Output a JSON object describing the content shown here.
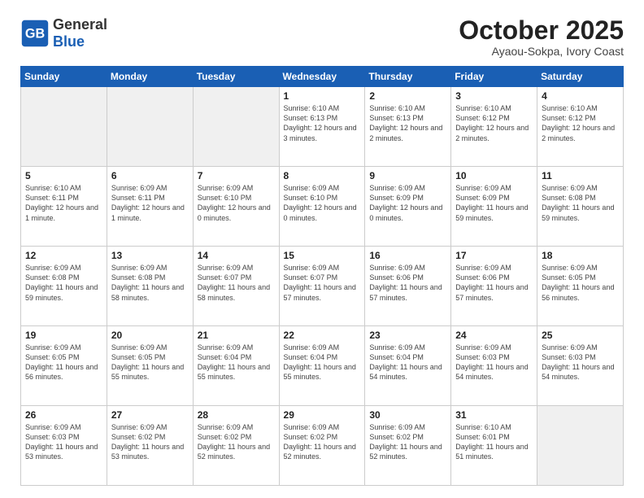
{
  "header": {
    "logo_general": "General",
    "logo_blue": "Blue",
    "month_title": "October 2025",
    "subtitle": "Ayaou-Sokpa, Ivory Coast"
  },
  "weekdays": [
    "Sunday",
    "Monday",
    "Tuesday",
    "Wednesday",
    "Thursday",
    "Friday",
    "Saturday"
  ],
  "weeks": [
    [
      {
        "day": "",
        "info": ""
      },
      {
        "day": "",
        "info": ""
      },
      {
        "day": "",
        "info": ""
      },
      {
        "day": "1",
        "info": "Sunrise: 6:10 AM\nSunset: 6:13 PM\nDaylight: 12 hours\nand 3 minutes."
      },
      {
        "day": "2",
        "info": "Sunrise: 6:10 AM\nSunset: 6:13 PM\nDaylight: 12 hours\nand 2 minutes."
      },
      {
        "day": "3",
        "info": "Sunrise: 6:10 AM\nSunset: 6:12 PM\nDaylight: 12 hours\nand 2 minutes."
      },
      {
        "day": "4",
        "info": "Sunrise: 6:10 AM\nSunset: 6:12 PM\nDaylight: 12 hours\nand 2 minutes."
      }
    ],
    [
      {
        "day": "5",
        "info": "Sunrise: 6:10 AM\nSunset: 6:11 PM\nDaylight: 12 hours\nand 1 minute."
      },
      {
        "day": "6",
        "info": "Sunrise: 6:09 AM\nSunset: 6:11 PM\nDaylight: 12 hours\nand 1 minute."
      },
      {
        "day": "7",
        "info": "Sunrise: 6:09 AM\nSunset: 6:10 PM\nDaylight: 12 hours\nand 0 minutes."
      },
      {
        "day": "8",
        "info": "Sunrise: 6:09 AM\nSunset: 6:10 PM\nDaylight: 12 hours\nand 0 minutes."
      },
      {
        "day": "9",
        "info": "Sunrise: 6:09 AM\nSunset: 6:09 PM\nDaylight: 12 hours\nand 0 minutes."
      },
      {
        "day": "10",
        "info": "Sunrise: 6:09 AM\nSunset: 6:09 PM\nDaylight: 11 hours\nand 59 minutes."
      },
      {
        "day": "11",
        "info": "Sunrise: 6:09 AM\nSunset: 6:08 PM\nDaylight: 11 hours\nand 59 minutes."
      }
    ],
    [
      {
        "day": "12",
        "info": "Sunrise: 6:09 AM\nSunset: 6:08 PM\nDaylight: 11 hours\nand 59 minutes."
      },
      {
        "day": "13",
        "info": "Sunrise: 6:09 AM\nSunset: 6:08 PM\nDaylight: 11 hours\nand 58 minutes."
      },
      {
        "day": "14",
        "info": "Sunrise: 6:09 AM\nSunset: 6:07 PM\nDaylight: 11 hours\nand 58 minutes."
      },
      {
        "day": "15",
        "info": "Sunrise: 6:09 AM\nSunset: 6:07 PM\nDaylight: 11 hours\nand 57 minutes."
      },
      {
        "day": "16",
        "info": "Sunrise: 6:09 AM\nSunset: 6:06 PM\nDaylight: 11 hours\nand 57 minutes."
      },
      {
        "day": "17",
        "info": "Sunrise: 6:09 AM\nSunset: 6:06 PM\nDaylight: 11 hours\nand 57 minutes."
      },
      {
        "day": "18",
        "info": "Sunrise: 6:09 AM\nSunset: 6:05 PM\nDaylight: 11 hours\nand 56 minutes."
      }
    ],
    [
      {
        "day": "19",
        "info": "Sunrise: 6:09 AM\nSunset: 6:05 PM\nDaylight: 11 hours\nand 56 minutes."
      },
      {
        "day": "20",
        "info": "Sunrise: 6:09 AM\nSunset: 6:05 PM\nDaylight: 11 hours\nand 55 minutes."
      },
      {
        "day": "21",
        "info": "Sunrise: 6:09 AM\nSunset: 6:04 PM\nDaylight: 11 hours\nand 55 minutes."
      },
      {
        "day": "22",
        "info": "Sunrise: 6:09 AM\nSunset: 6:04 PM\nDaylight: 11 hours\nand 55 minutes."
      },
      {
        "day": "23",
        "info": "Sunrise: 6:09 AM\nSunset: 6:04 PM\nDaylight: 11 hours\nand 54 minutes."
      },
      {
        "day": "24",
        "info": "Sunrise: 6:09 AM\nSunset: 6:03 PM\nDaylight: 11 hours\nand 54 minutes."
      },
      {
        "day": "25",
        "info": "Sunrise: 6:09 AM\nSunset: 6:03 PM\nDaylight: 11 hours\nand 54 minutes."
      }
    ],
    [
      {
        "day": "26",
        "info": "Sunrise: 6:09 AM\nSunset: 6:03 PM\nDaylight: 11 hours\nand 53 minutes."
      },
      {
        "day": "27",
        "info": "Sunrise: 6:09 AM\nSunset: 6:02 PM\nDaylight: 11 hours\nand 53 minutes."
      },
      {
        "day": "28",
        "info": "Sunrise: 6:09 AM\nSunset: 6:02 PM\nDaylight: 11 hours\nand 52 minutes."
      },
      {
        "day": "29",
        "info": "Sunrise: 6:09 AM\nSunset: 6:02 PM\nDaylight: 11 hours\nand 52 minutes."
      },
      {
        "day": "30",
        "info": "Sunrise: 6:09 AM\nSunset: 6:02 PM\nDaylight: 11 hours\nand 52 minutes."
      },
      {
        "day": "31",
        "info": "Sunrise: 6:10 AM\nSunset: 6:01 PM\nDaylight: 11 hours\nand 51 minutes."
      },
      {
        "day": "",
        "info": ""
      }
    ]
  ]
}
